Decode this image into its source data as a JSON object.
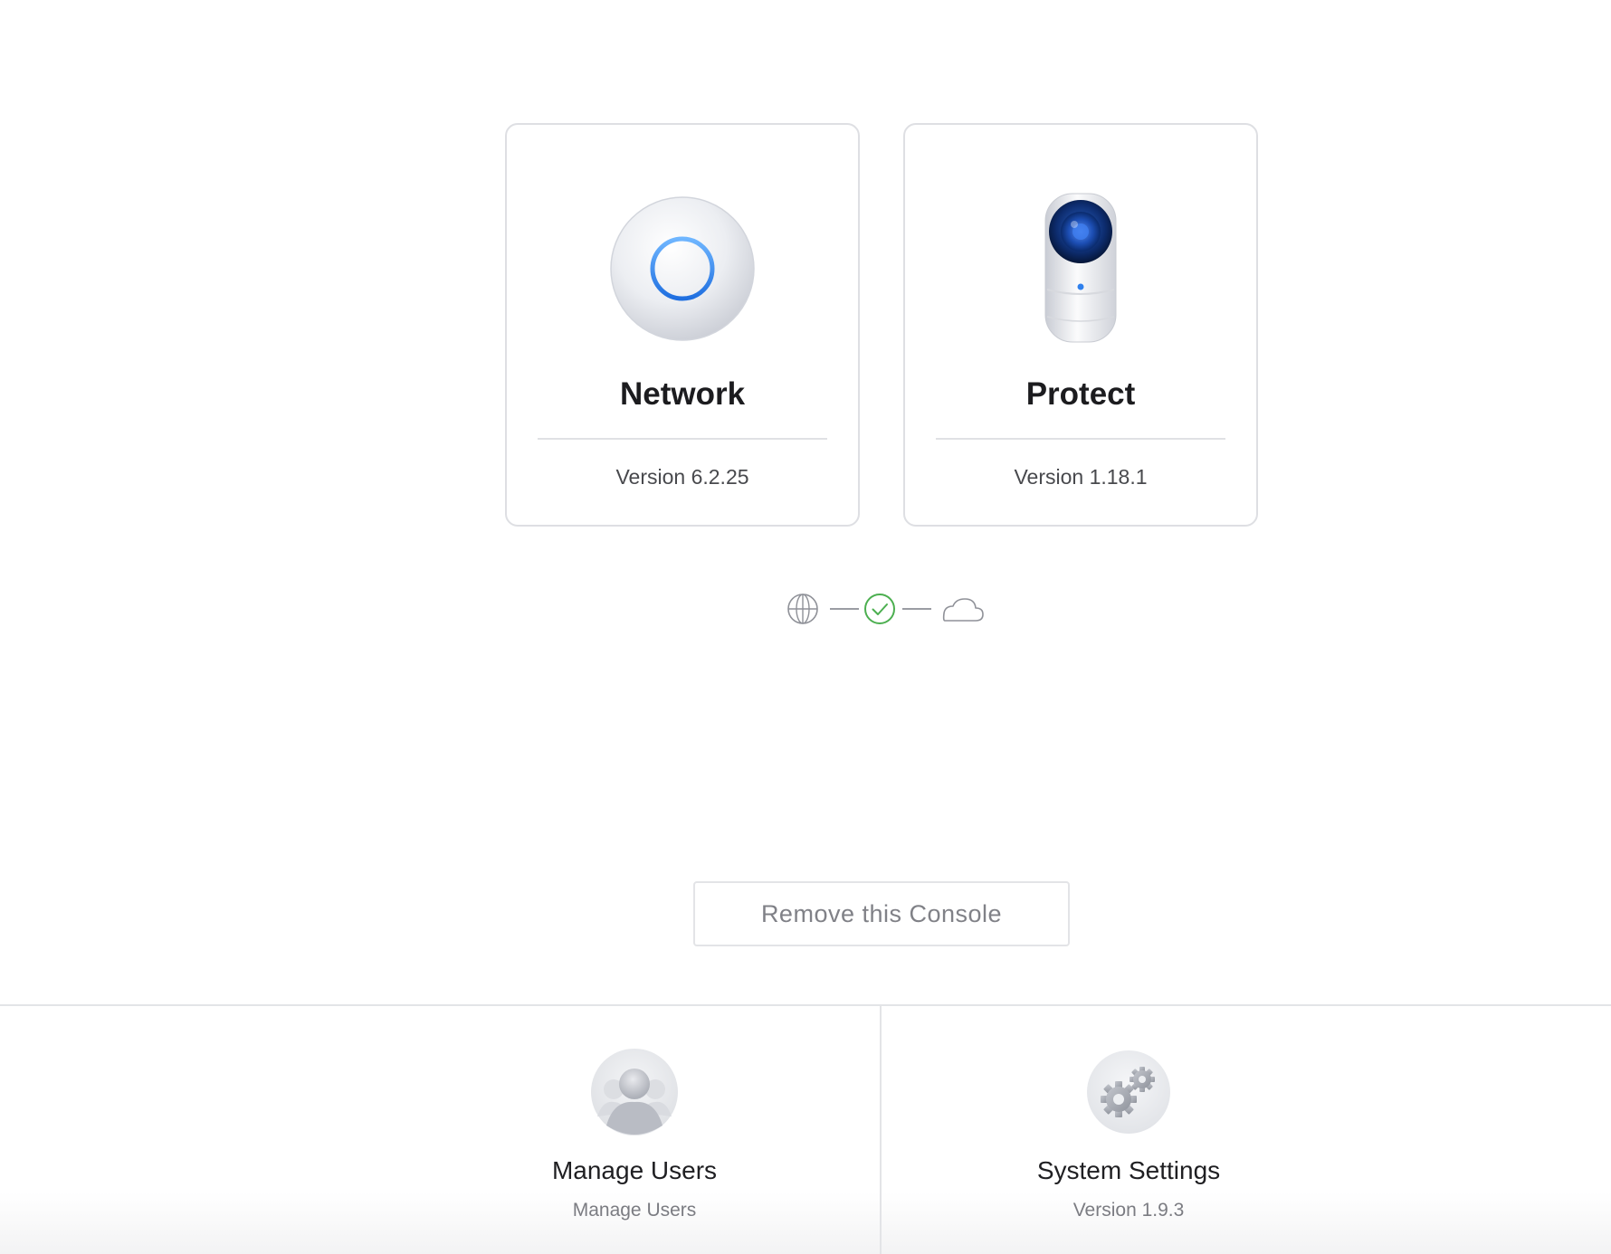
{
  "apps": [
    {
      "name": "Network",
      "version": "Version 6.2.25",
      "icon": "access-point-icon"
    },
    {
      "name": "Protect",
      "version": "Version 1.18.1",
      "icon": "camera-icon"
    }
  ],
  "connection": {
    "icons": [
      "globe-icon",
      "check-circle-icon",
      "cloud-icon"
    ],
    "status_color": "#4caf50"
  },
  "remove_button": {
    "label": "Remove this Console"
  },
  "bottom_tiles": [
    {
      "title": "Manage Users",
      "subtitle": "Manage Users",
      "icon": "users-icon"
    },
    {
      "title": "System Settings",
      "subtitle": "Version 1.9.3",
      "icon": "gears-icon"
    }
  ],
  "colors": {
    "accent": "#2f80ed",
    "border": "#dedfe3"
  }
}
